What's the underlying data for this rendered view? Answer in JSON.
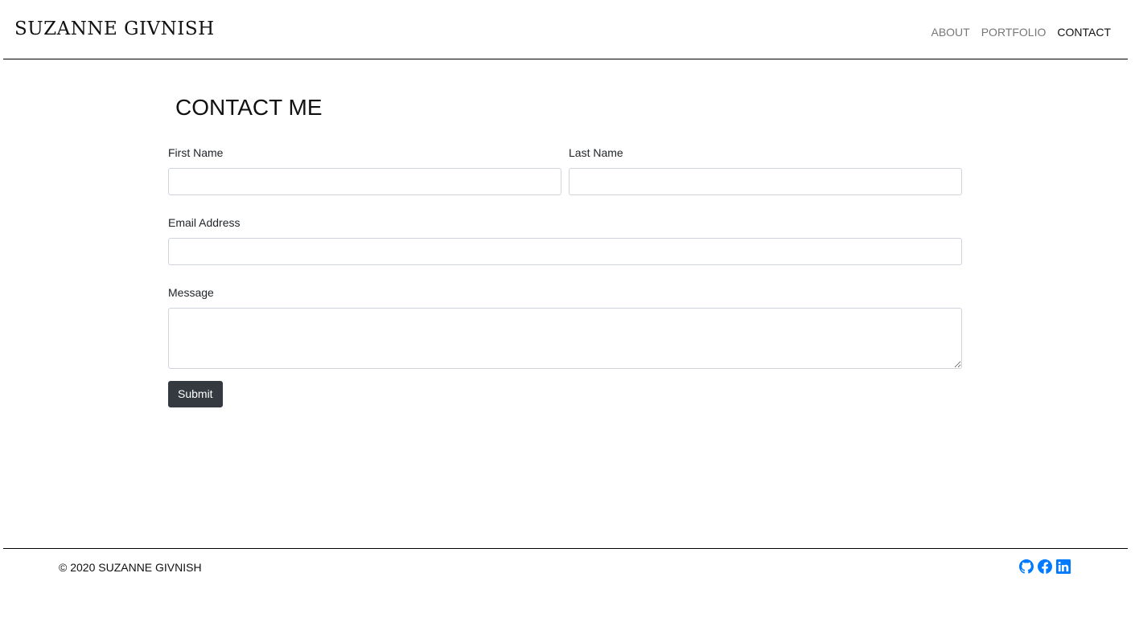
{
  "header": {
    "brand": "SUZANNE GIVNISH",
    "nav": [
      {
        "label": "ABOUT"
      },
      {
        "label": "PORTFOLIO"
      },
      {
        "label": "CONTACT"
      }
    ]
  },
  "main": {
    "title": "CONTACT ME",
    "fields": {
      "first_name": {
        "label": "First Name",
        "value": ""
      },
      "last_name": {
        "label": "Last Name",
        "value": ""
      },
      "email": {
        "label": "Email Address",
        "value": ""
      },
      "message": {
        "label": "Message",
        "value": ""
      }
    },
    "submit_label": "Submit"
  },
  "footer": {
    "copyright": "© 2020 SUZANNE GIVNISH",
    "social_icons": [
      "github-icon",
      "facebook-icon",
      "linkedin-icon"
    ]
  },
  "colors": {
    "accent": "#007bff",
    "button": "#343a40",
    "nav_inactive": "#777777",
    "nav_active": "#111111"
  }
}
